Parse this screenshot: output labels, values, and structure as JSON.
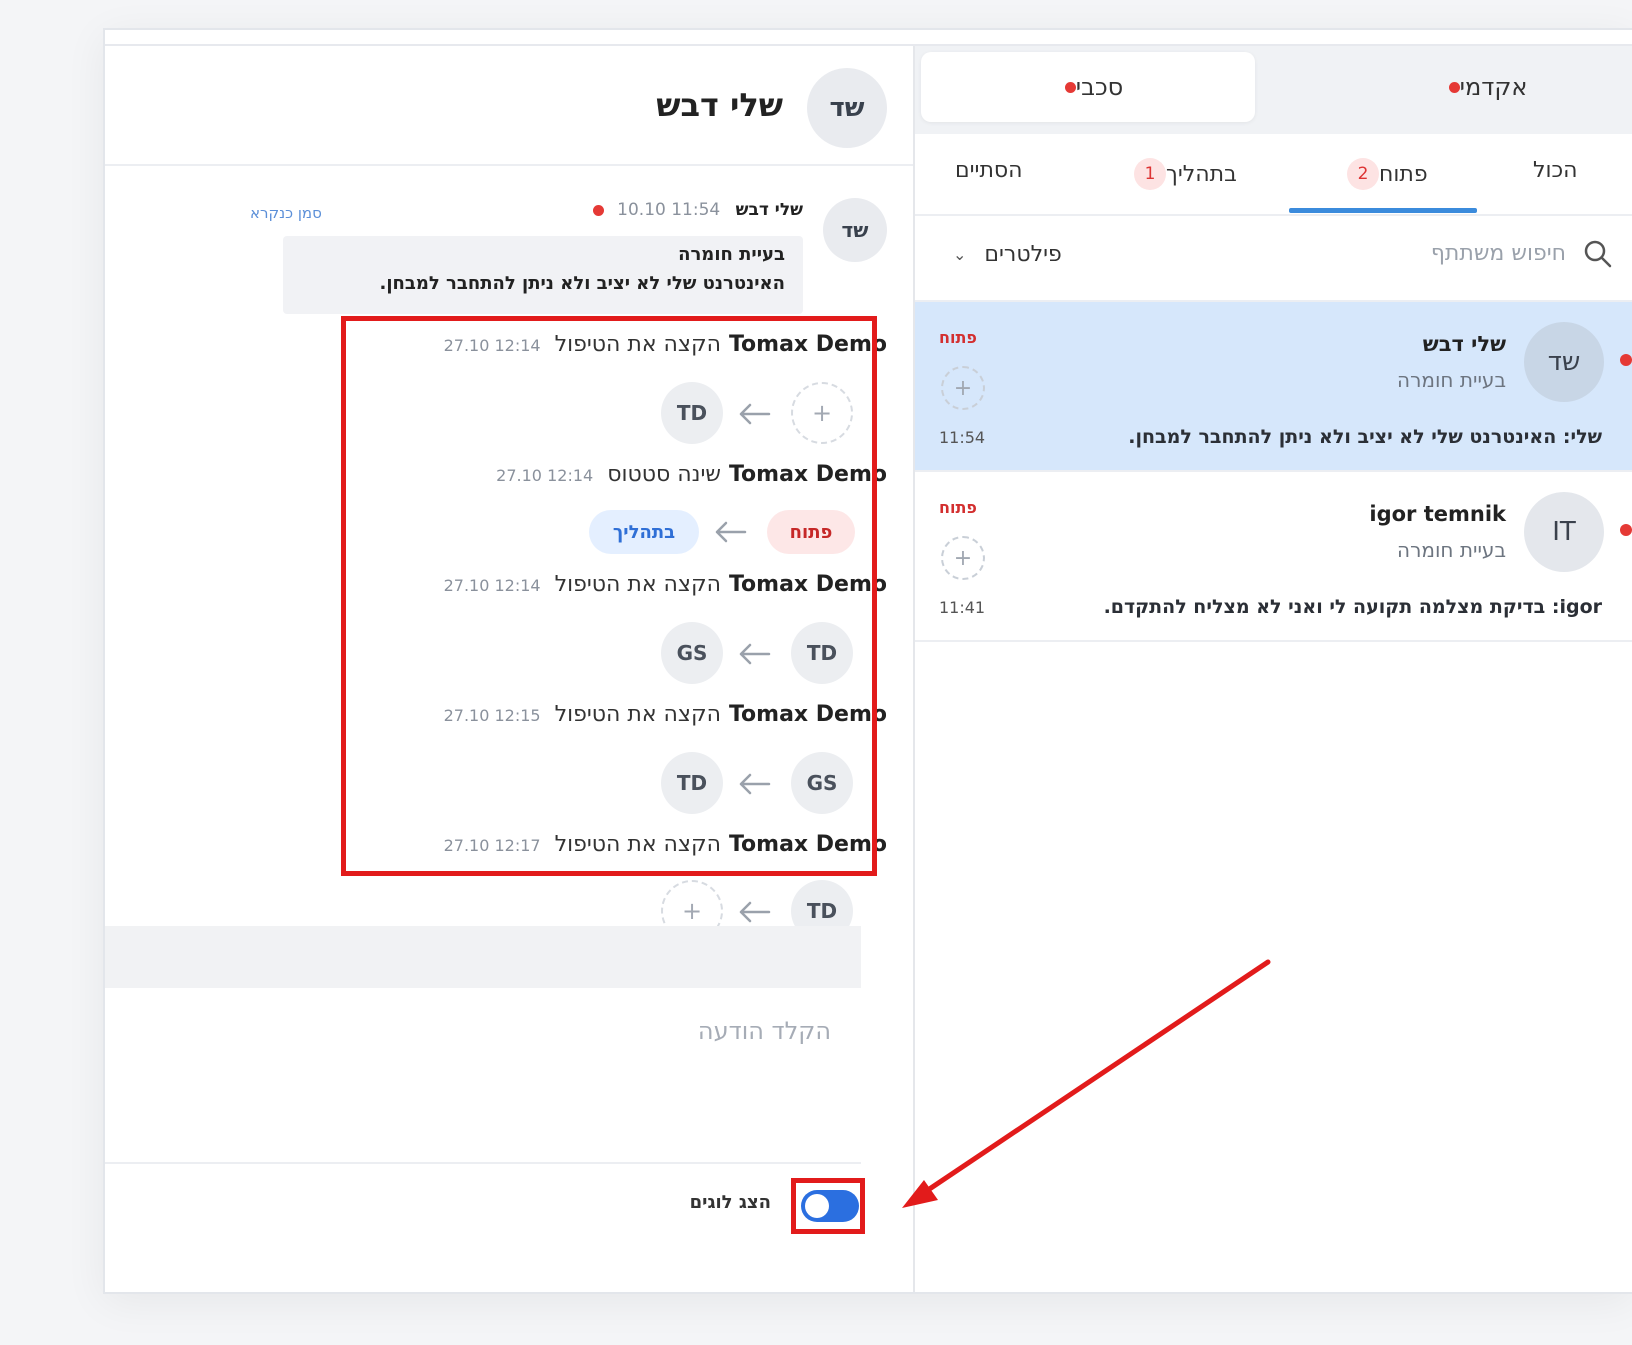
{
  "chat": {
    "header": {
      "initials": "שד",
      "name": "שלי דבש"
    },
    "message": {
      "initials": "שד",
      "sender": "שלי דבש",
      "time": "11:54 10.10",
      "mark_read": "סמן כנקרא",
      "subject": "בעיית חומרה",
      "body": "האינטרנט שלי לא יציב ולא ניתן להתחבר למבחן."
    },
    "events": [
      {
        "who": "Tomax Demo",
        "what": "הקצה את הטיפול",
        "ts": "12:14 27.10",
        "from": "+",
        "to": "TD"
      },
      {
        "who": "Tomax Demo",
        "what": "שינה סטטוס",
        "ts": "12:14 27.10",
        "from": "פתוח",
        "to": "בתהליך"
      },
      {
        "who": "Tomax Demo",
        "what": "הקצה את הטיפול",
        "ts": "12:14 27.10",
        "from": "TD",
        "to": "GS"
      },
      {
        "who": "Tomax Demo",
        "what": "הקצה את הטיפול",
        "ts": "12:15 27.10",
        "from": "GS",
        "to": "TD"
      },
      {
        "who": "Tomax Demo",
        "what": "הקצה את הטיפול",
        "ts": "12:17 27.10",
        "from": "TD",
        "to": "+"
      }
    ],
    "compose_placeholder": "הקלד הודעה",
    "toggle": {
      "label": "הצג לוגים",
      "on": true
    }
  },
  "sidebar": {
    "segments": [
      {
        "label": "סכבי",
        "active": true
      },
      {
        "label": "אקדמי",
        "active": false
      }
    ],
    "tabs": [
      {
        "label": "הכול",
        "badge": ""
      },
      {
        "label": "פתוח",
        "badge": "2"
      },
      {
        "label": "בתהליך",
        "badge": "1"
      },
      {
        "label": "הסתיים",
        "badge": ""
      }
    ],
    "search_placeholder": "חיפוש משתתף",
    "filters_label": "פילטרים",
    "conversations": [
      {
        "initials": "שד",
        "name": "שלי דבש",
        "subject": "בעיית חומרה",
        "preview": "שלי: האינטרנט שלי לא יציב ולא ניתן להתחבר למבחן.",
        "status": "פתוח",
        "time": "11:54",
        "add": "+"
      },
      {
        "initials": "IT",
        "name": "igor temnik",
        "subject": "בעיית חומרה",
        "preview": "igor: בדיקת מצלמה תקועה לי ואני לא מצליח להתקדם.",
        "status": "פתוח",
        "time": "11:41",
        "add": "+"
      }
    ]
  },
  "colors": {
    "accent": "#2b6fe0",
    "annotation": "#e21b1b",
    "status_open": "#d32f2f",
    "selected_row": "#d6e7fb"
  }
}
